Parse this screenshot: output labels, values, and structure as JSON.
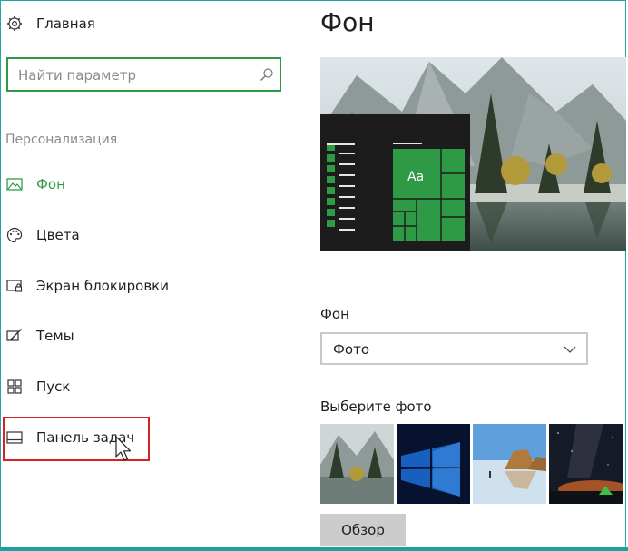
{
  "sidebar": {
    "home_label": "Главная",
    "search_placeholder": "Найти параметр",
    "section_title": "Персонализация",
    "items": [
      {
        "label": "Фон",
        "icon": "picture-icon",
        "active": true
      },
      {
        "label": "Цвета",
        "icon": "palette-icon"
      },
      {
        "label": "Экран блокировки",
        "icon": "lock-screen-icon"
      },
      {
        "label": "Темы",
        "icon": "brush-icon"
      },
      {
        "label": "Пуск",
        "icon": "start-grid-icon"
      },
      {
        "label": "Панель задач",
        "icon": "taskbar-icon"
      }
    ]
  },
  "main": {
    "title": "Фон",
    "preview_tile_label": "Aa",
    "background_label": "Фон",
    "background_value": "Фото",
    "choose_photo_label": "Выберите фото",
    "browse_label": "Обзор"
  },
  "colors": {
    "accent": "#2f9a46",
    "highlight_box": "#d61f26",
    "frame": "#1ea0a0"
  }
}
